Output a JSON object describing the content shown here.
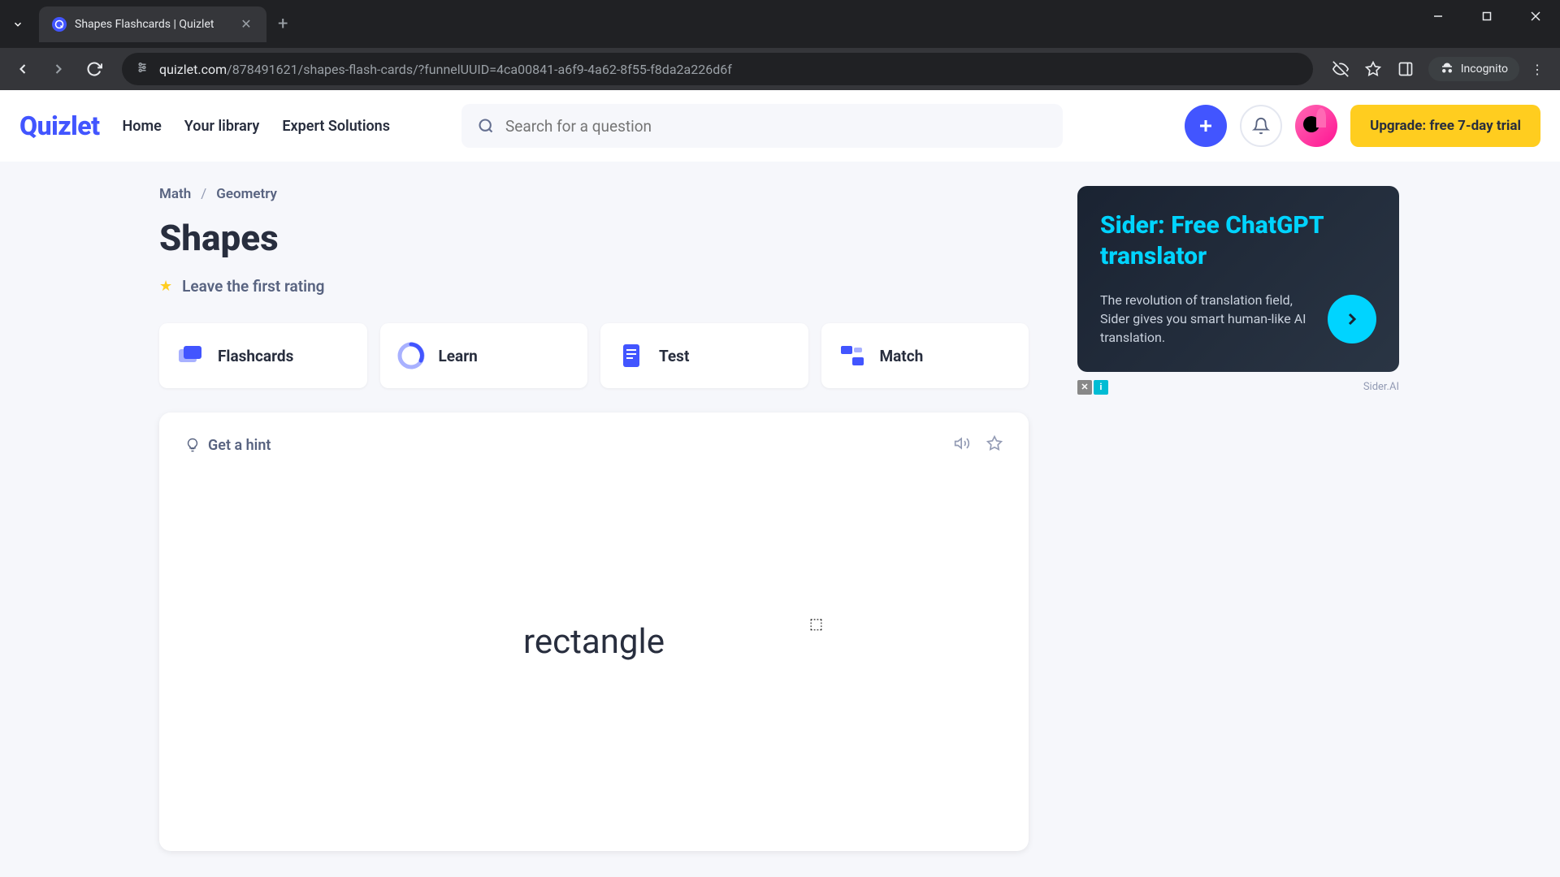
{
  "browser": {
    "tab_title": "Shapes Flashcards | Quizlet",
    "url_domain": "quizlet.com",
    "url_path": "/878491621/shapes-flash-cards/?funnelUUID=4ca00841-a6f9-4a62-8f55-f8da2a226d6f",
    "incognito_label": "Incognito"
  },
  "header": {
    "logo": "Quizlet",
    "nav": {
      "home": "Home",
      "library": "Your library",
      "expert": "Expert Solutions"
    },
    "search_placeholder": "Search for a question",
    "upgrade_label": "Upgrade: free 7-day trial"
  },
  "breadcrumb": {
    "math": "Math",
    "geometry": "Geometry"
  },
  "page": {
    "title": "Shapes",
    "rating_text": "Leave the first rating"
  },
  "modes": {
    "flashcards": "Flashcards",
    "learn": "Learn",
    "test": "Test",
    "match": "Match"
  },
  "card": {
    "hint_label": "Get a hint",
    "term": "rectangle"
  },
  "ad": {
    "title": "Sider: Free ChatGPT translator",
    "body": "The revolution of translation field, Sider gives you smart human-like AI translation.",
    "attribution": "Sider.AI"
  }
}
